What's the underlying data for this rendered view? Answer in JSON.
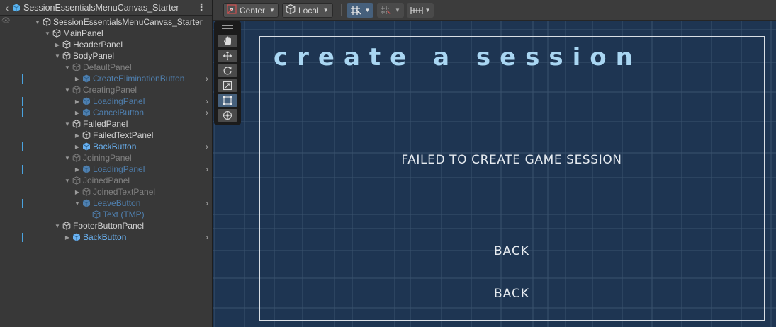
{
  "hierarchy": {
    "title": "SessionEssentialsMenuCanvas_Starter",
    "back_icon": "chevron-left-icon",
    "menu_icon": "kebab-menu-icon",
    "items": [
      {
        "label": "SessionEssentialsMenuCanvas_Starter",
        "depth": 0,
        "arrow": "▼",
        "color": "white",
        "icon": "gameobject-icon"
      },
      {
        "label": "MainPanel",
        "depth": 1,
        "arrow": "▼",
        "color": "white",
        "icon": "gameobject-icon"
      },
      {
        "label": "HeaderPanel",
        "depth": 2,
        "arrow": "▶",
        "color": "white",
        "icon": "gameobject-icon"
      },
      {
        "label": "BodyPanel",
        "depth": 2,
        "arrow": "▼",
        "color": "white",
        "icon": "gameobject-icon"
      },
      {
        "label": "DefaultPanel",
        "depth": 3,
        "arrow": "▼",
        "color": "grey",
        "icon": "gameobject-icon"
      },
      {
        "label": "CreateEliminationButton",
        "depth": 4,
        "arrow": "▶",
        "color": "blue-dim",
        "icon": "prefab-icon",
        "chev": true,
        "bar": true
      },
      {
        "label": "CreatingPanel",
        "depth": 3,
        "arrow": "▼",
        "color": "grey",
        "icon": "gameobject-icon"
      },
      {
        "label": "LoadingPanel",
        "depth": 4,
        "arrow": "▶",
        "color": "blue-dim",
        "icon": "prefab-icon",
        "chev": true,
        "bar": true
      },
      {
        "label": "CancelButton",
        "depth": 4,
        "arrow": "▶",
        "color": "blue-dim",
        "icon": "prefab-icon",
        "chev": true,
        "bar": true
      },
      {
        "label": "FailedPanel",
        "depth": 3,
        "arrow": "▼",
        "color": "white",
        "icon": "gameobject-icon"
      },
      {
        "label": "FailedTextPanel",
        "depth": 4,
        "arrow": "▶",
        "color": "white",
        "icon": "gameobject-icon"
      },
      {
        "label": "BackButton",
        "depth": 4,
        "arrow": "▶",
        "color": "blue",
        "icon": "prefab-icon",
        "chev": true,
        "bar": true
      },
      {
        "label": "JoiningPanel",
        "depth": 3,
        "arrow": "▼",
        "color": "grey",
        "icon": "gameobject-icon"
      },
      {
        "label": "LoadingPanel",
        "depth": 4,
        "arrow": "▶",
        "color": "blue-dim",
        "icon": "prefab-icon",
        "chev": true,
        "bar": true
      },
      {
        "label": "JoinedPanel",
        "depth": 3,
        "arrow": "▼",
        "color": "grey",
        "icon": "gameobject-icon"
      },
      {
        "label": "JoinedTextPanel",
        "depth": 4,
        "arrow": "▶",
        "color": "grey",
        "icon": "gameobject-icon"
      },
      {
        "label": "LeaveButton",
        "depth": 4,
        "arrow": "▼",
        "color": "blue-dim",
        "icon": "prefab-icon",
        "chev": true,
        "bar": true
      },
      {
        "label": "Text (TMP)",
        "depth": 5,
        "arrow": "",
        "color": "blue-dim",
        "icon": "gameobject-icon"
      },
      {
        "label": "FooterButtonPanel",
        "depth": 2,
        "arrow": "▼",
        "color": "white",
        "icon": "gameobject-icon"
      },
      {
        "label": "BackButton",
        "depth": 3,
        "arrow": "▶",
        "color": "blue",
        "icon": "prefab-icon",
        "chev": true,
        "bar": true
      }
    ]
  },
  "toolbar": {
    "pivot_label": "Center",
    "space_label": "Local",
    "pivot_icon": "pivot-center-icon",
    "space_icon": "local-space-icon",
    "grid_snap_icon": "grid-snap-icon",
    "increment_snap_icon": "increment-snap-icon",
    "ruler_icon": "ruler-icon"
  },
  "tools": [
    {
      "name": "hand-tool",
      "icon": "hand-icon",
      "active": false
    },
    {
      "name": "move-tool",
      "icon": "move-arrows-icon",
      "active": false
    },
    {
      "name": "rotate-tool",
      "icon": "rotate-icon",
      "active": false
    },
    {
      "name": "scale-tool",
      "icon": "scale-icon",
      "active": false
    },
    {
      "name": "rect-tool",
      "icon": "rect-transform-icon",
      "active": true
    },
    {
      "name": "transform-tool",
      "icon": "transform-icon",
      "active": false
    }
  ],
  "scene": {
    "title": "create a session",
    "message": "FAILED TO CREATE GAME SESSION",
    "back_button_1": "BACK",
    "back_button_2": "BACK",
    "colors": {
      "background": "#1e3552",
      "title": "#a9d6f2",
      "text": "#e6ebf0",
      "border": "#d9dee4"
    }
  }
}
